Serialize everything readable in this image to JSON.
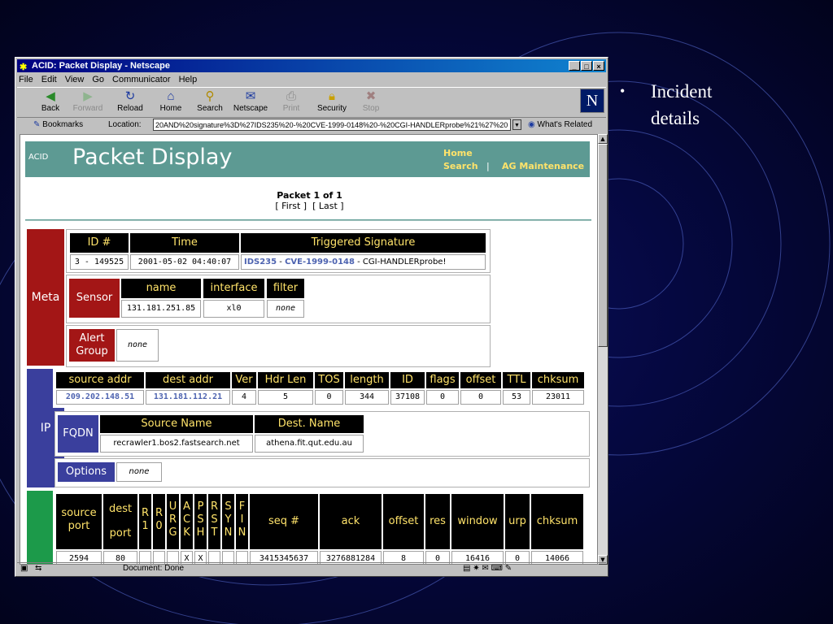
{
  "slide": {
    "bullet": "•",
    "text": "Incident details"
  },
  "window": {
    "title": "ACID: Packet Display - Netscape",
    "controls": [
      "_",
      "□",
      "×"
    ],
    "menu": [
      "File",
      "Edit",
      "View",
      "Go",
      "Communicator",
      "Help"
    ],
    "toolbar": [
      {
        "label": "Back",
        "icon": "back-arrow-icon",
        "enabled": true
      },
      {
        "label": "Forward",
        "icon": "forward-arrow-icon",
        "enabled": false
      },
      {
        "label": "Reload",
        "icon": "reload-icon",
        "enabled": true
      },
      {
        "label": "Home",
        "icon": "home-icon",
        "enabled": true
      },
      {
        "label": "Search",
        "icon": "search-icon",
        "enabled": true
      },
      {
        "label": "Netscape",
        "icon": "netscape-icon",
        "enabled": true
      },
      {
        "label": "Print",
        "icon": "print-icon",
        "enabled": false
      },
      {
        "label": "Security",
        "icon": "lock-icon",
        "enabled": true
      },
      {
        "label": "Stop",
        "icon": "stop-icon",
        "enabled": false
      }
    ],
    "logo": "N",
    "bookmarks": "Bookmarks",
    "location_label": "Location:",
    "location_value": "20AND%20signature%3D%27IDS235%20-%20CVE-1999-0148%20-%20CGI-HANDLERprobe%21%27%20",
    "whats_related": "What's Related",
    "status": "Document: Done"
  },
  "page": {
    "acid": "ACID",
    "title": "Packet Display",
    "links": {
      "home": "Home",
      "search": "Search",
      "sep": "|",
      "maint": "AG Maintenance"
    },
    "packet_of": "Packet 1 of 1",
    "first": "[ First ]",
    "last": "[ Last ]",
    "meta": {
      "label": "Meta",
      "headers": [
        "ID #",
        "Time",
        "Triggered Signature"
      ],
      "id": "3 - 149525",
      "time": "2001-05-02 04:40:07",
      "sig_ids": "IDS235",
      "sig_dash1": " - ",
      "sig_cve": "CVE-1999-0148",
      "sig_rest": " - CGI-HANDLERprobe!",
      "sensor_label": "Sensor",
      "sensor_headers": [
        "name",
        "interface",
        "filter"
      ],
      "sensor_name": "131.181.251.85",
      "sensor_interface": "xl0",
      "sensor_filter": "none",
      "alert_group_label": "Alert Group",
      "alert_group_value": "none"
    },
    "ip": {
      "label": "IP",
      "headers": [
        "source addr",
        "dest addr",
        "Ver",
        "Hdr Len",
        "TOS",
        "length",
        "ID",
        "flags",
        "offset",
        "TTL",
        "chksum"
      ],
      "values": [
        "209.202.148.51",
        "131.181.112.21",
        "4",
        "5",
        "0",
        "344",
        "37108",
        "0",
        "0",
        "53",
        "23011"
      ],
      "fqdn_label": "FQDN",
      "fqdn_headers": [
        "Source Name",
        "Dest. Name"
      ],
      "fqdn_values": [
        "recrawler1.bos2.fastsearch.net",
        "athena.fit.qut.edu.au"
      ],
      "options_label": "Options",
      "options_value": "none"
    },
    "tcp": {
      "headers": [
        "source port",
        "dest port",
        "R 1",
        "R 0",
        "U R G",
        "A C K",
        "P S H",
        "R S T",
        "S Y N",
        "F I N",
        "seq #",
        "ack",
        "offset",
        "res",
        "window",
        "urp",
        "chksum"
      ],
      "values": [
        "2594",
        "80",
        "",
        "",
        "",
        "X",
        "X",
        "",
        "",
        "",
        "3415345637",
        "3276881284",
        "8",
        "0",
        "16416",
        "0",
        "14066"
      ]
    }
  }
}
